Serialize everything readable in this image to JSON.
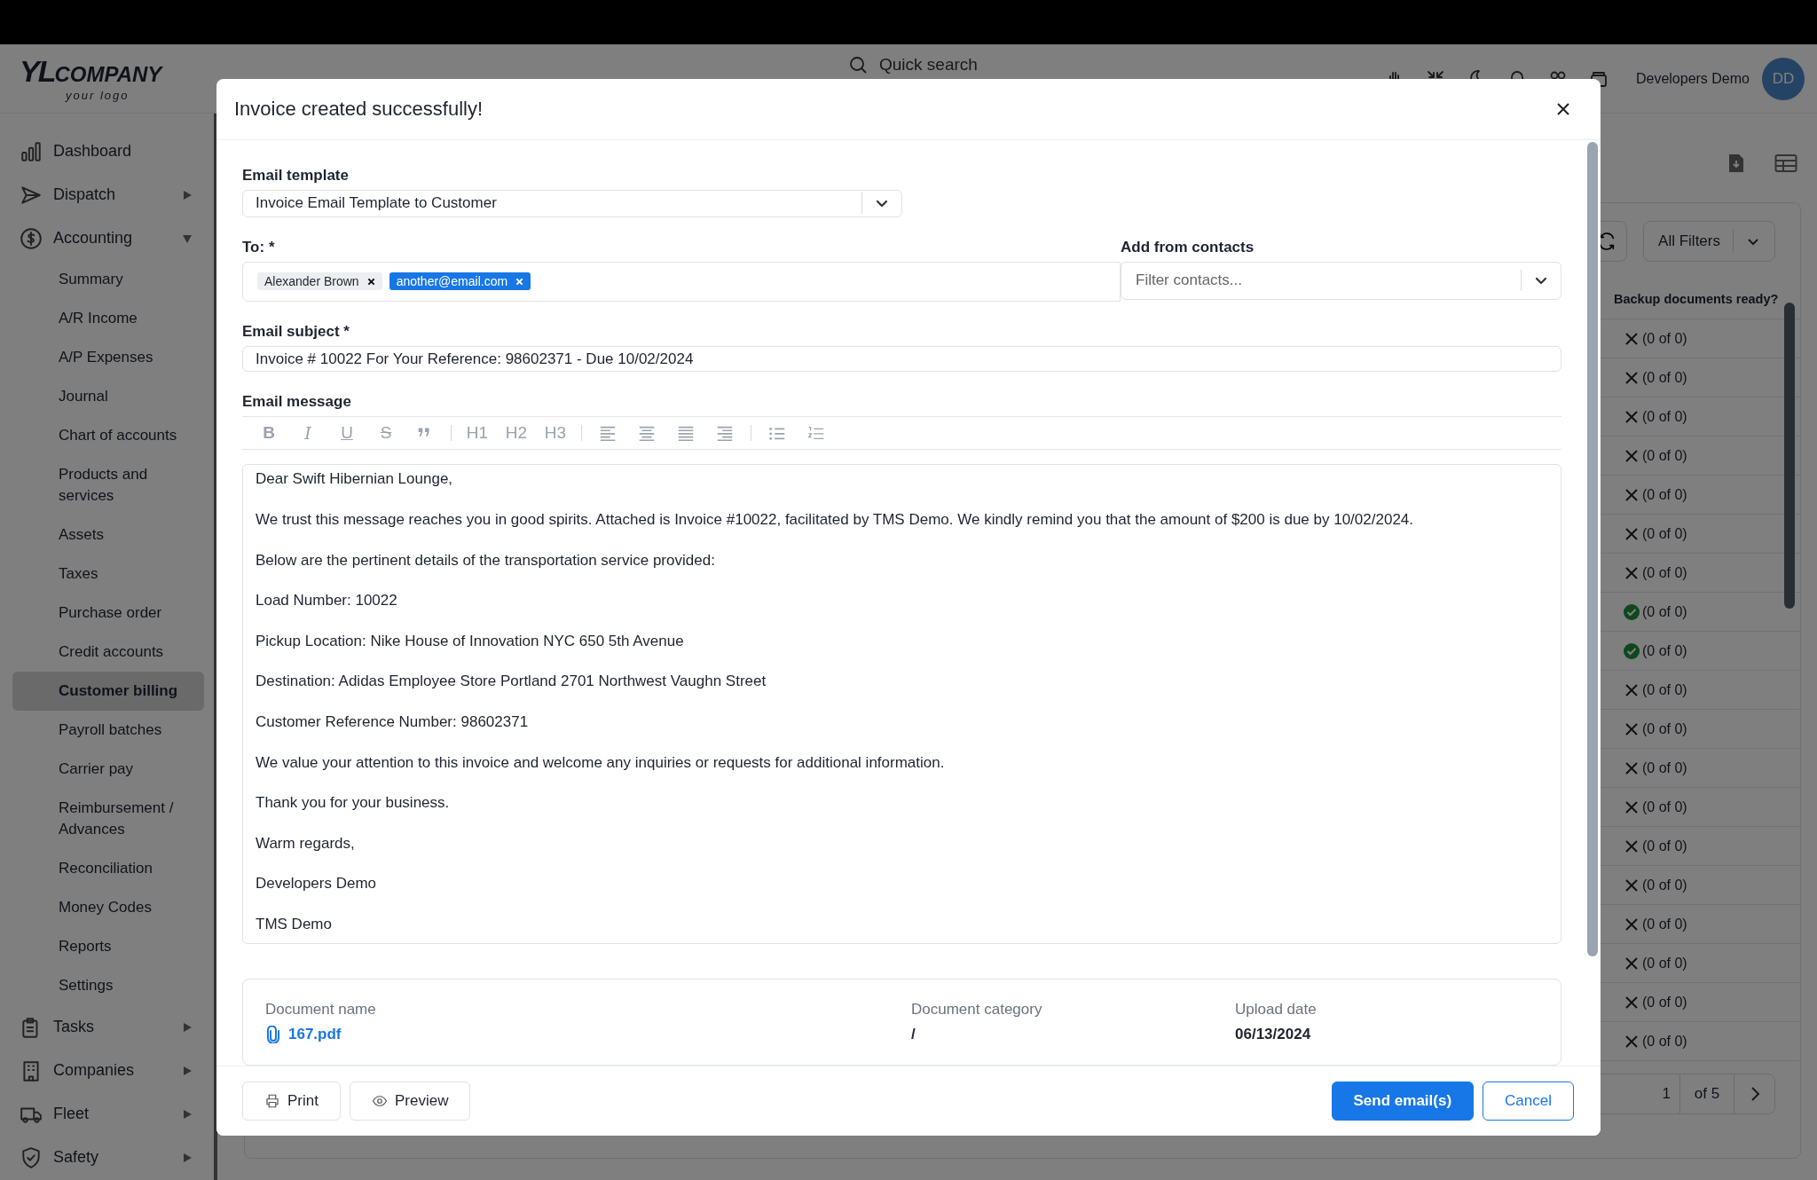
{
  "header": {
    "logo": {
      "mark": "YL",
      "name": "COMPANY",
      "tagline": "your logo"
    },
    "search_placeholder": "Quick search",
    "user_name": "Developers Demo",
    "avatar": "DD"
  },
  "sidebar": {
    "items": [
      {
        "label": "Dashboard",
        "kind": "link"
      },
      {
        "label": "Dispatch",
        "kind": "group",
        "expanded": false
      },
      {
        "label": "Accounting",
        "kind": "group",
        "expanded": true,
        "children": [
          {
            "label": "Summary",
            "selected": false
          },
          {
            "label": "A/R Income",
            "selected": false
          },
          {
            "label": "A/P Expenses",
            "selected": false
          },
          {
            "label": "Journal",
            "selected": false
          },
          {
            "label": "Chart of accounts",
            "selected": false
          },
          {
            "label": "Products and services",
            "selected": false
          },
          {
            "label": "Assets",
            "selected": false
          },
          {
            "label": "Taxes",
            "selected": false
          },
          {
            "label": "Purchase order",
            "selected": false
          },
          {
            "label": "Credit accounts",
            "selected": false
          },
          {
            "label": "Customer billing",
            "selected": true
          },
          {
            "label": "Payroll batches",
            "selected": false
          },
          {
            "label": "Carrier pay",
            "selected": false
          },
          {
            "label": "Reimbursement / Advances",
            "selected": false
          },
          {
            "label": "Reconciliation",
            "selected": false
          },
          {
            "label": "Money Codes",
            "selected": false
          },
          {
            "label": "Reports",
            "selected": false
          },
          {
            "label": "Settings",
            "selected": false
          }
        ]
      },
      {
        "label": "Tasks",
        "kind": "group",
        "expanded": false
      },
      {
        "label": "Companies",
        "kind": "group",
        "expanded": false
      },
      {
        "label": "Fleet",
        "kind": "group",
        "expanded": false
      },
      {
        "label": "Safety",
        "kind": "group",
        "expanded": false
      }
    ]
  },
  "table": {
    "filter_label": "All Filters",
    "column": "Backup documents ready?",
    "rows": [
      {
        "ready": false,
        "text": "(0 of 0)"
      },
      {
        "ready": false,
        "text": "(0 of 0)"
      },
      {
        "ready": false,
        "text": "(0 of 0)"
      },
      {
        "ready": false,
        "text": "(0 of 0)"
      },
      {
        "ready": false,
        "text": "(0 of 0)"
      },
      {
        "ready": false,
        "text": "(0 of 0)"
      },
      {
        "ready": false,
        "text": "(0 of 0)"
      },
      {
        "ready": true,
        "text": "(0 of 0)"
      },
      {
        "ready": true,
        "text": "(0 of 0)"
      },
      {
        "ready": false,
        "text": "(0 of 0)"
      },
      {
        "ready": false,
        "text": "(0 of 0)"
      },
      {
        "ready": false,
        "text": "(0 of 0)"
      },
      {
        "ready": false,
        "text": "(0 of 0)"
      },
      {
        "ready": false,
        "text": "(0 of 0)"
      },
      {
        "ready": false,
        "text": "(0 of 0)"
      },
      {
        "ready": false,
        "text": "(0 of 0)"
      },
      {
        "ready": false,
        "text": "(0 of 0)"
      },
      {
        "ready": false,
        "text": "(0 of 0)"
      },
      {
        "ready": false,
        "text": "(0 of 0)"
      }
    ],
    "pagination": {
      "page": "1",
      "total": "of 5"
    }
  },
  "modal": {
    "title": "Invoice created successfully!",
    "template": {
      "label": "Email template",
      "value": "Invoice Email Template to Customer"
    },
    "to": {
      "label": "To: *",
      "recipients": [
        {
          "label": "Alexander Brown",
          "selected": false
        },
        {
          "label": "another@email.com",
          "selected": true
        }
      ]
    },
    "contacts": {
      "label": "Add from contacts",
      "placeholder": "Filter contacts..."
    },
    "subject": {
      "label": "Email subject *",
      "value": "Invoice # 10022 For Your Reference: 98602371 - Due 10/02/2024"
    },
    "message": {
      "label": "Email message",
      "toolbar": [
        {
          "kind": "bold",
          "label": "B"
        },
        {
          "kind": "italic",
          "label": "I"
        },
        {
          "kind": "underline",
          "label": "U"
        },
        {
          "kind": "strike",
          "label": "S"
        },
        {
          "kind": "quote"
        },
        {
          "kind": "separator"
        },
        {
          "kind": "heading",
          "label": "H1"
        },
        {
          "kind": "heading",
          "label": "H2"
        },
        {
          "kind": "heading",
          "label": "H3"
        },
        {
          "kind": "separator"
        },
        {
          "kind": "align-left"
        },
        {
          "kind": "align-center"
        },
        {
          "kind": "align-justify"
        },
        {
          "kind": "align-right"
        },
        {
          "kind": "separator"
        },
        {
          "kind": "bullet-list"
        },
        {
          "kind": "numbered-list"
        }
      ],
      "paragraphs": [
        "Dear Swift Hibernian Lounge,",
        "We trust this message reaches you in good spirits. Attached is Invoice #10022, facilitated by TMS Demo. We kindly remind you that the amount of $200 is due by 10/02/2024.",
        "Below are the pertinent details of the transportation service provided:",
        "Load Number: 10022",
        "Pickup Location: Nike House of Innovation NYC 650 5th Avenue",
        "Destination: Adidas Employee Store Portland 2701 Northwest Vaughn Street",
        "Customer Reference Number: 98602371",
        "We value your attention to this invoice and welcome any inquiries or requests for additional information.",
        "Thank you for your business.",
        "Warm regards,",
        "Developers Demo",
        "TMS Demo"
      ]
    },
    "documents": {
      "columns": [
        "Document name",
        "Document category",
        "Upload date"
      ],
      "rows": [
        {
          "name": "167.pdf",
          "category": "/",
          "date": "06/13/2024"
        }
      ]
    },
    "footer_buttons": [
      {
        "kind": "print",
        "label": "Print"
      },
      {
        "kind": "preview",
        "label": "Preview"
      },
      {
        "kind": "primary",
        "label": "Send email(s)"
      },
      {
        "kind": "cancel",
        "label": "Cancel"
      }
    ]
  }
}
